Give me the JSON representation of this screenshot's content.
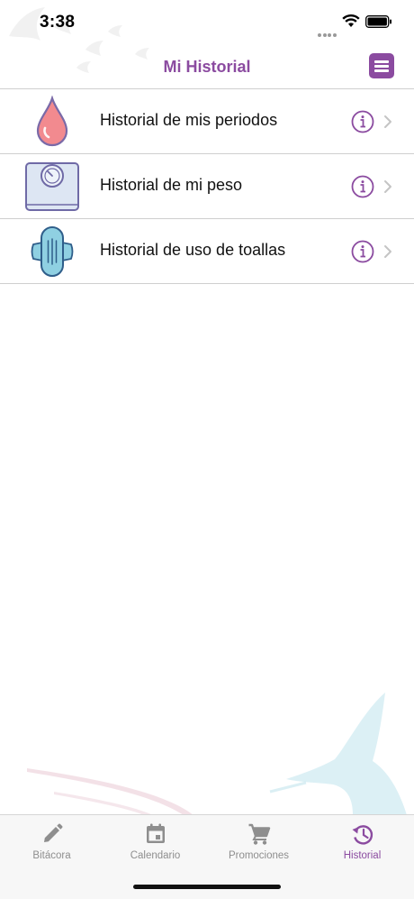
{
  "status_bar": {
    "time": "3:38"
  },
  "nav": {
    "title": "Mi Historial",
    "menu_icon": "hamburger-menu-icon"
  },
  "rows": [
    {
      "label": "Historial de mis periodos",
      "icon": "blood-drop-icon"
    },
    {
      "label": "Historial de mi peso",
      "icon": "weight-scale-icon"
    },
    {
      "label": "Historial de uso de toallas",
      "icon": "sanitary-pad-icon"
    }
  ],
  "tabs": [
    {
      "label": "Bitácora",
      "icon": "pencil-icon",
      "active": false
    },
    {
      "label": "Calendario",
      "icon": "calendar-icon",
      "active": false
    },
    {
      "label": "Promociones",
      "icon": "cart-icon",
      "active": false
    },
    {
      "label": "Historial",
      "icon": "history-icon",
      "active": true
    }
  ],
  "colors": {
    "accent": "#8b4ba0",
    "inactive": "#8e8e8e",
    "separator": "#cfcfcf"
  }
}
